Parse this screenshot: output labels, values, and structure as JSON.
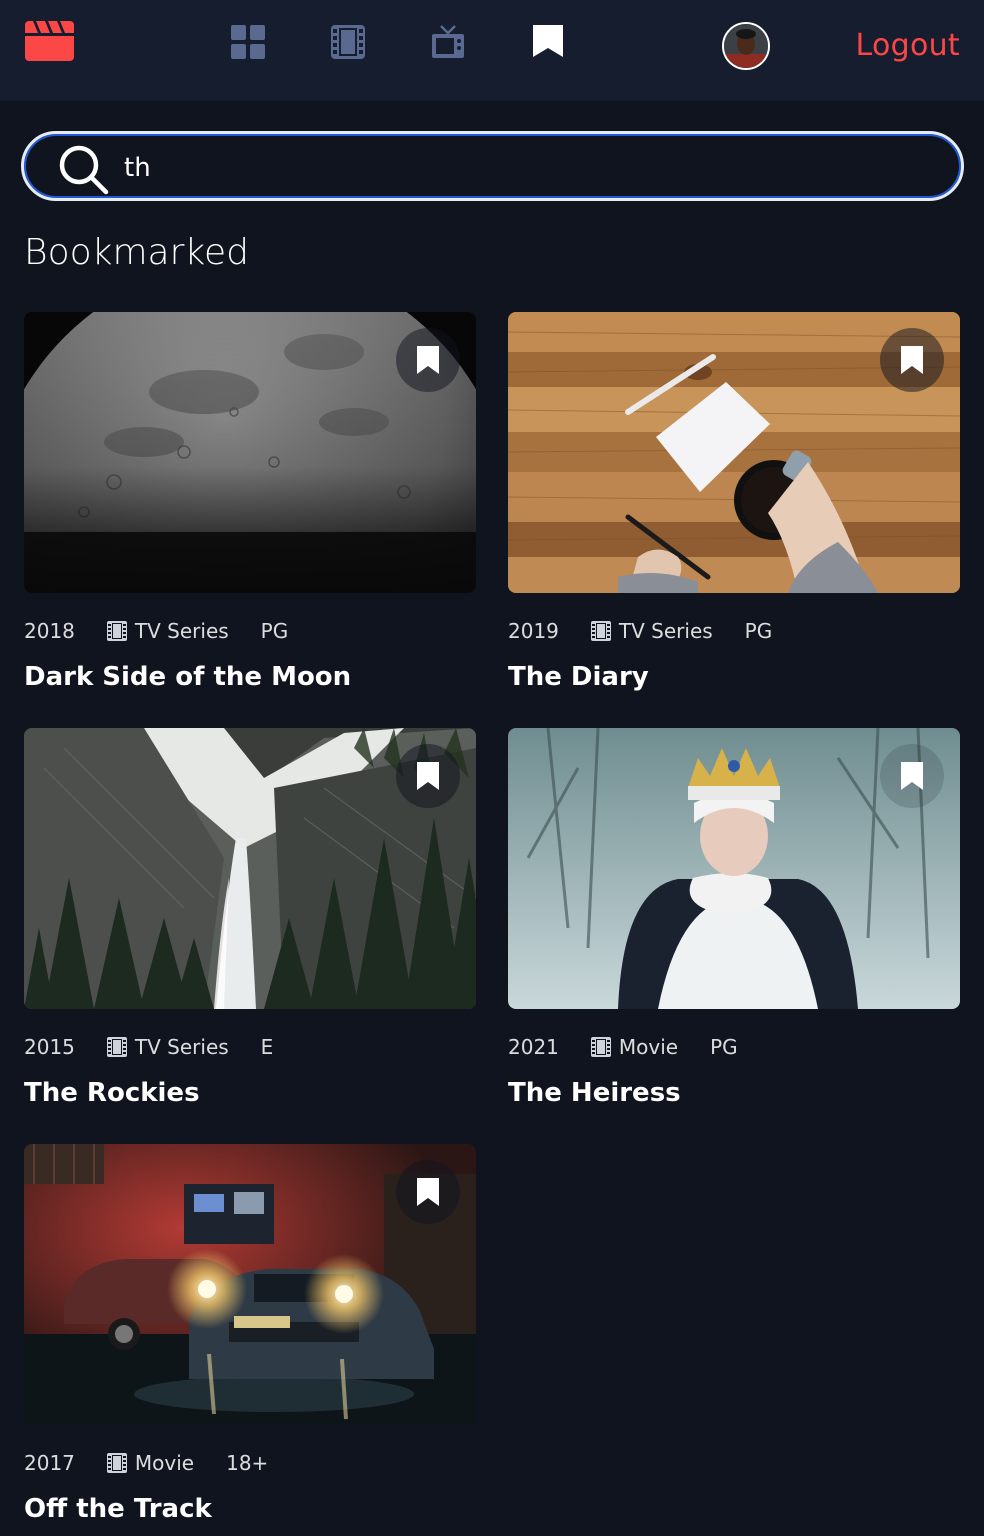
{
  "colors": {
    "background": "#10141E",
    "topbar": "#161D2F",
    "accent": "#FC4747",
    "nav_icon_inactive": "#5A698F",
    "nav_icon_active": "#FFFFFF",
    "search_border": "#E6ECF7"
  },
  "header": {
    "logo_icon": "movie-clapper-icon",
    "nav": [
      {
        "name": "home",
        "icon": "grid-icon",
        "active": false
      },
      {
        "name": "movies",
        "icon": "film-icon",
        "active": false
      },
      {
        "name": "tv-series",
        "icon": "tv-icon",
        "active": false
      },
      {
        "name": "bookmarks",
        "icon": "bookmark-icon",
        "active": true
      }
    ],
    "logout_label": "Logout"
  },
  "search": {
    "value": "th",
    "placeholder": ""
  },
  "section_title": "Bookmarked",
  "items": [
    {
      "year": "2018",
      "category": "TV Series",
      "category_icon": "tv-series-icon",
      "rating": "PG",
      "title": "Dark Side of the Moon",
      "bookmarked": true
    },
    {
      "year": "2019",
      "category": "TV Series",
      "category_icon": "tv-series-icon",
      "rating": "PG",
      "title": "The Diary",
      "bookmarked": true
    },
    {
      "year": "2015",
      "category": "TV Series",
      "category_icon": "tv-series-icon",
      "rating": "E",
      "title": "The Rockies",
      "bookmarked": true
    },
    {
      "year": "2021",
      "category": "Movie",
      "category_icon": "film-icon",
      "rating": "PG",
      "title": "The Heiress",
      "bookmarked": true
    },
    {
      "year": "2017",
      "category": "Movie",
      "category_icon": "film-icon",
      "rating": "18+",
      "title": "Off the Track",
      "bookmarked": true
    }
  ]
}
